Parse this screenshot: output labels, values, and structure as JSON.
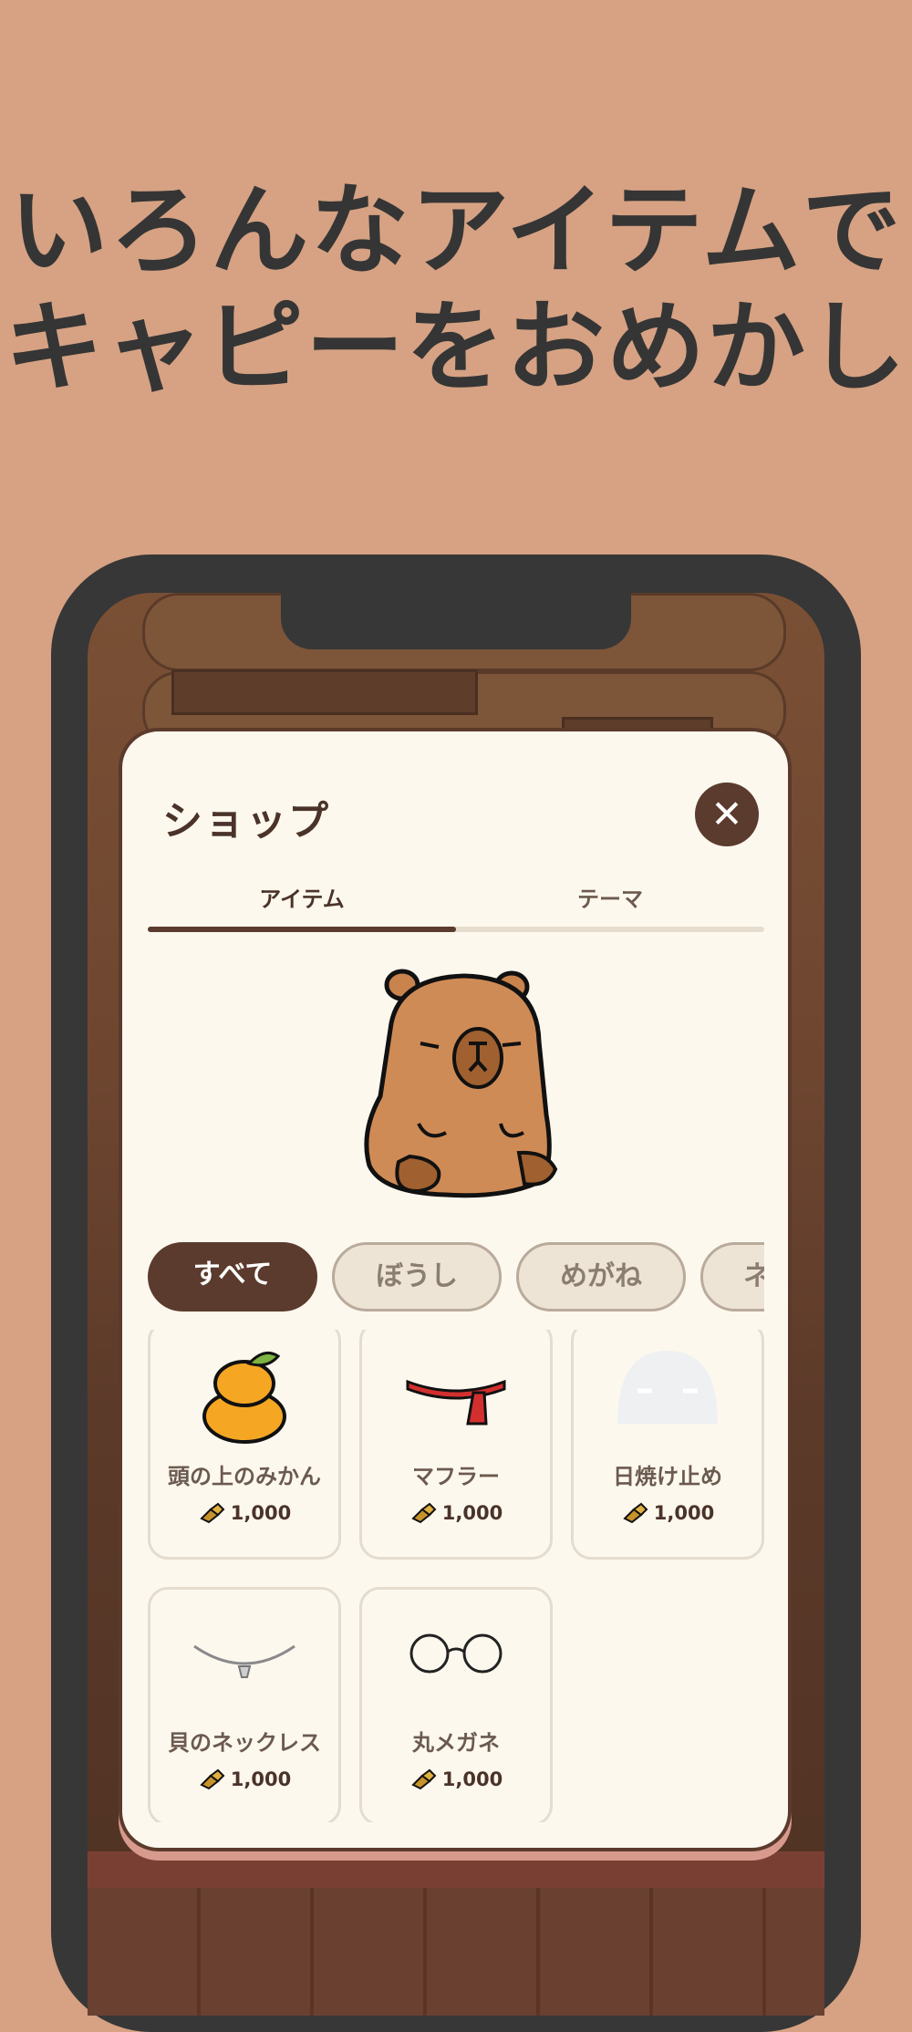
{
  "headline": {
    "line1": "いろんなアイテムで",
    "line2": "キャピーをおめかし"
  },
  "shop": {
    "title": "ショップ",
    "close_icon": "close-icon",
    "tabs": [
      {
        "label": "アイテム",
        "active": true
      },
      {
        "label": "テーマ",
        "active": false
      }
    ],
    "categories": [
      {
        "label": "すべて",
        "active": true
      },
      {
        "label": "ぼうし",
        "active": false
      },
      {
        "label": "めがね",
        "active": false
      },
      {
        "label": "ネ",
        "active": false
      }
    ],
    "items": [
      {
        "name": "頭の上のみかん",
        "price": "1,000",
        "icon": "mikan-icon"
      },
      {
        "name": "マフラー",
        "price": "1,000",
        "icon": "scarf-icon"
      },
      {
        "name": "日焼け止め",
        "price": "1,000",
        "icon": "sunscreen-icon"
      },
      {
        "name": "貝のネックレス",
        "price": "1,000",
        "icon": "shell-necklace-icon"
      },
      {
        "name": "丸メガネ",
        "price": "1,000",
        "icon": "round-glasses-icon"
      }
    ]
  },
  "colors": {
    "background": "#d6a283",
    "accent": "#5b3b2d",
    "modal": "#fdf8ee"
  }
}
